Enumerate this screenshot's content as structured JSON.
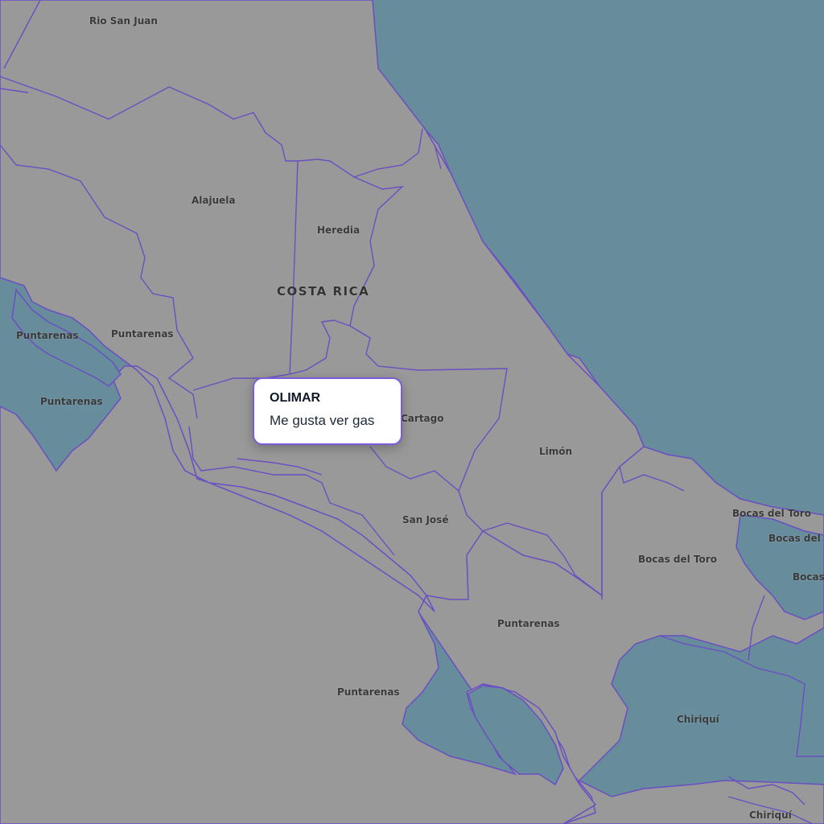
{
  "map": {
    "colors": {
      "water": "#678c9c",
      "land": "#999999",
      "border": "#6a4fc2",
      "popup_border": "#7c5cdb"
    },
    "country_label": "COSTA RICA",
    "region_labels": [
      "Rio San Juan",
      "Alajuela",
      "Heredia",
      "Puntarenas",
      "Puntarenas",
      "Puntarenas",
      "Cartago",
      "Limón",
      "San José",
      "Bocas del Toro",
      "Bocas del Toro",
      "Bocas del T",
      "Bocas",
      "Puntarenas",
      "Puntarenas",
      "Chiriquí",
      "Chiriquí"
    ]
  },
  "popup": {
    "title": "OLIMAR",
    "text": "Me gusta ver gas"
  }
}
